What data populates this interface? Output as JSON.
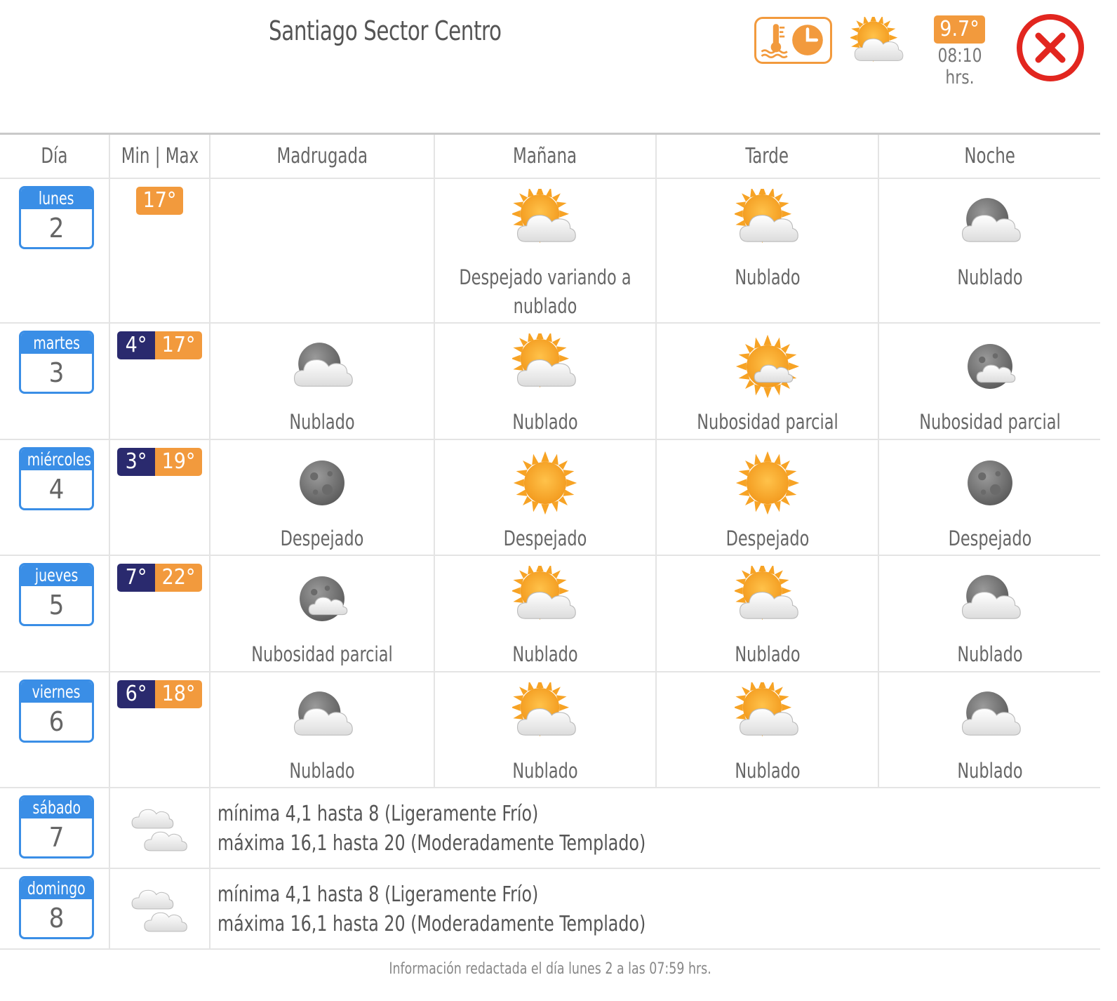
{
  "header": {
    "title": "Santiago Sector Centro",
    "current_temp": "9.7°",
    "current_time": "08:10 hrs.",
    "current_icon": "sun-cloud-icon"
  },
  "table": {
    "columns": [
      "Día",
      "Min | Max",
      "Madrugada",
      "Mañana",
      "Tarde",
      "Noche"
    ],
    "rows": [
      {
        "day": "lunes",
        "num": "2",
        "min": "",
        "max": "17°",
        "periods": [
          {
            "icon": "",
            "label": ""
          },
          {
            "icon": "sun-cloud",
            "label": "Despejado variando a nublado"
          },
          {
            "icon": "sun-cloud",
            "label": "Nublado"
          },
          {
            "icon": "moon-cloud",
            "label": "Nublado"
          }
        ]
      },
      {
        "day": "martes",
        "num": "3",
        "min": "4°",
        "max": "17°",
        "periods": [
          {
            "icon": "moon-cloud",
            "label": "Nublado"
          },
          {
            "icon": "sun-cloud",
            "label": "Nublado"
          },
          {
            "icon": "sun-small-cloud",
            "label": "Nubosidad parcial"
          },
          {
            "icon": "moon-small-cloud",
            "label": "Nubosidad parcial"
          }
        ]
      },
      {
        "day": "miércoles",
        "num": "4",
        "min": "3°",
        "max": "19°",
        "periods": [
          {
            "icon": "moon",
            "label": "Despejado"
          },
          {
            "icon": "sun",
            "label": "Despejado"
          },
          {
            "icon": "sun",
            "label": "Despejado"
          },
          {
            "icon": "moon",
            "label": "Despejado"
          }
        ]
      },
      {
        "day": "jueves",
        "num": "5",
        "min": "7°",
        "max": "22°",
        "periods": [
          {
            "icon": "moon-small-cloud",
            "label": "Nubosidad parcial"
          },
          {
            "icon": "sun-cloud",
            "label": "Nublado"
          },
          {
            "icon": "sun-cloud",
            "label": "Nublado"
          },
          {
            "icon": "moon-cloud",
            "label": "Nublado"
          }
        ]
      },
      {
        "day": "viernes",
        "num": "6",
        "min": "6°",
        "max": "18°",
        "periods": [
          {
            "icon": "moon-cloud",
            "label": "Nublado"
          },
          {
            "icon": "sun-cloud",
            "label": "Nublado"
          },
          {
            "icon": "sun-cloud",
            "label": "Nublado"
          },
          {
            "icon": "moon-cloud",
            "label": "Nublado"
          }
        ]
      }
    ],
    "weekend": [
      {
        "day": "sábado",
        "num": "7",
        "icon": "clouds-icon",
        "line1": "mínima 4,1 hasta 8 (Ligeramente Frío)",
        "line2": "máxima 16,1 hasta 20 (Moderadamente Templado)"
      },
      {
        "day": "domingo",
        "num": "8",
        "icon": "clouds-icon",
        "line1": "mínima 4,1 hasta 8 (Ligeramente Frío)",
        "line2": "máxima 16,1 hasta 20 (Moderadamente Templado)"
      }
    ]
  },
  "footer": "Información redactada el día lunes 2 a las 07:59 hrs.",
  "colors": {
    "accent_orange": "#f29a3d",
    "min_navy": "#2a2a6e",
    "calendar_blue": "#3a8ee6",
    "close_red": "#e2261f"
  }
}
